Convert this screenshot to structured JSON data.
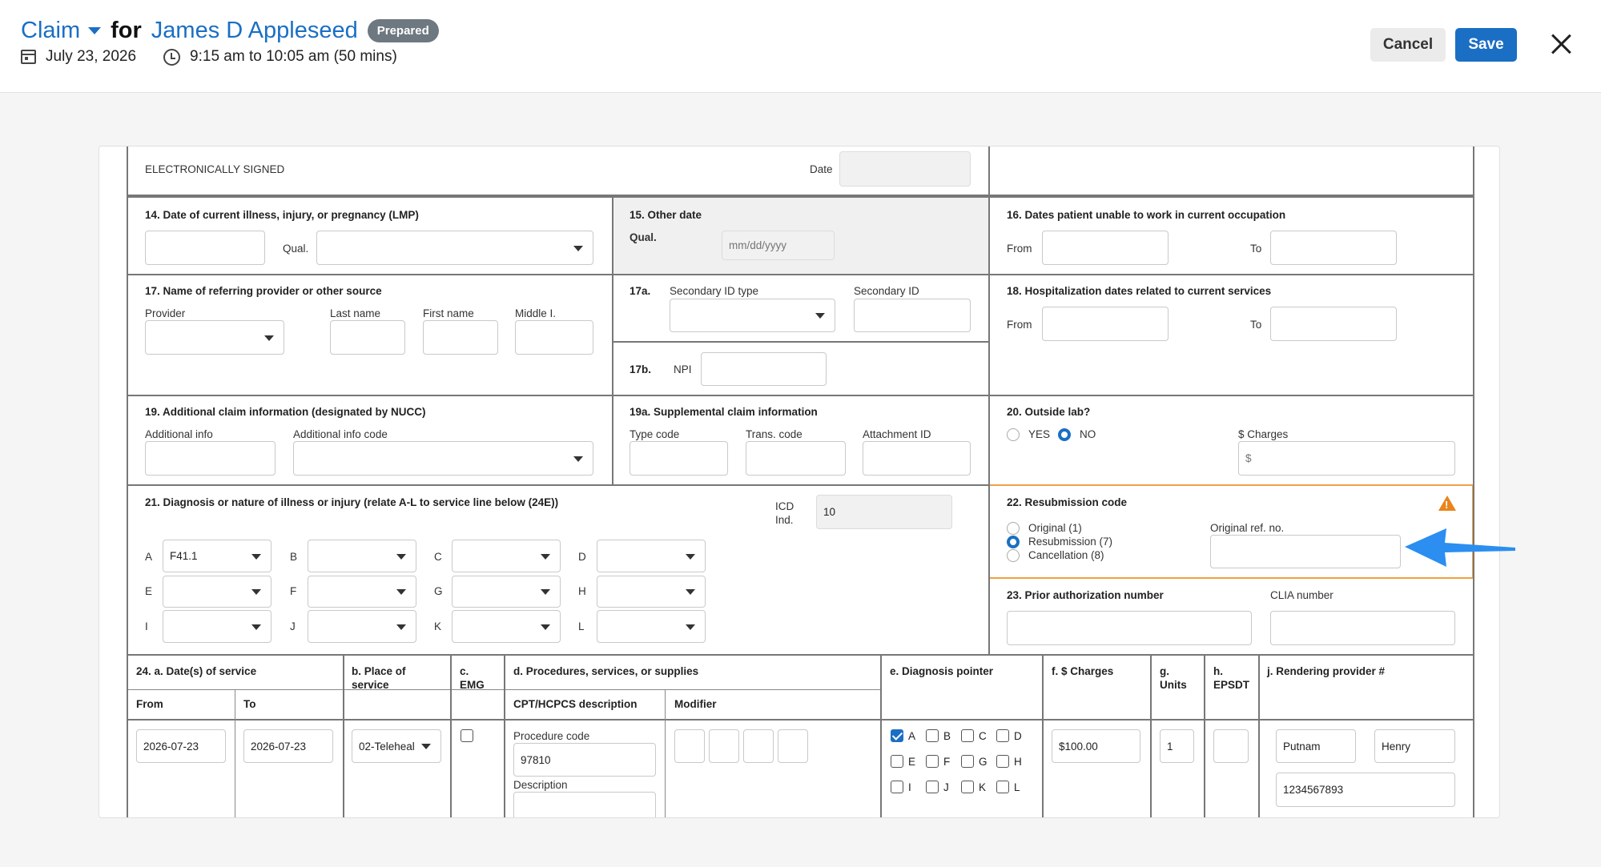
{
  "header": {
    "claim_label": "Claim",
    "for_label": "for",
    "patient_name": "James D Appleseed",
    "status_badge": "Prepared",
    "date": "July 23, 2026",
    "time": "9:15 am to 10:05 am (50 mins)",
    "cancel_label": "Cancel",
    "save_label": "Save"
  },
  "colors": {
    "accent": "#1a6fc4",
    "warning": "#e8851c",
    "highlight_border": "#f0a044",
    "badge": "#6e7880"
  },
  "signed": {
    "text": "ELECTRONICALLY SIGNED",
    "date_label": "Date"
  },
  "box14": {
    "title": "14. Date of current illness, injury, or pregnancy (LMP)",
    "qual_label": "Qual."
  },
  "box15": {
    "title": "15. Other date",
    "qual_label": "Qual.",
    "date_placeholder": "mm/dd/yyyy"
  },
  "box16": {
    "title": "16. Dates patient unable to work in current occupation",
    "from_label": "From",
    "to_label": "To"
  },
  "box17": {
    "title": "17. Name of referring provider or other source",
    "provider_label": "Provider",
    "last_name_label": "Last name",
    "first_name_label": "First name",
    "middle_label": "Middle I."
  },
  "box17a": {
    "num": "17a.",
    "secondary_type_label": "Secondary ID type",
    "secondary_id_label": "Secondary ID"
  },
  "box17b": {
    "num": "17b.",
    "npi_label": "NPI"
  },
  "box18": {
    "title": "18. Hospitalization dates related to current services",
    "from_label": "From",
    "to_label": "To"
  },
  "box19": {
    "title": "19. Additional claim information (designated by NUCC)",
    "info_label": "Additional info",
    "code_label": "Additional info code"
  },
  "box19a": {
    "title": "19a. Supplemental claim information",
    "type_label": "Type code",
    "trans_label": "Trans. code",
    "attach_label": "Attachment ID"
  },
  "box20": {
    "title": "20. Outside lab?",
    "yes_label": "YES",
    "no_label": "NO",
    "selected": "NO",
    "charges_label": "$ Charges",
    "charges_placeholder": "$"
  },
  "box21": {
    "title": "21. Diagnosis or nature of illness or injury (relate A-L to service line below (24E))",
    "icd_label_1": "ICD",
    "icd_label_2": "Ind.",
    "icd_value": "10",
    "letters": [
      "A",
      "B",
      "C",
      "D",
      "E",
      "F",
      "G",
      "H",
      "I",
      "J",
      "K",
      "L"
    ],
    "values": [
      "F41.1",
      "",
      "",
      "",
      "",
      "",
      "",
      "",
      "",
      "",
      "",
      ""
    ]
  },
  "box22": {
    "title": "22. Resubmission code",
    "options": [
      "Original (1)",
      "Resubmission (7)",
      "Cancellation (8)"
    ],
    "selected": "Resubmission (7)",
    "orig_ref_label": "Original ref. no.",
    "warning_icon": "warning-triangle-icon"
  },
  "box23": {
    "title": "23. Prior authorization number",
    "clia_label": "CLIA number"
  },
  "box24": {
    "a_title": "24. a. Date(s) of service",
    "from_label": "From",
    "to_label": "To",
    "b_title_1": "b. Place of",
    "b_title_2": "service",
    "c_title_1": "c.",
    "c_title_2": "EMG",
    "d_title": "d. Procedures, services, or supplies",
    "cpt_label": "CPT/HCPCS description",
    "modifier_label": "Modifier",
    "e_title": "e. Diagnosis pointer",
    "f_title": "f. $ Charges",
    "g_title_1": "g.",
    "g_title_2": "Units",
    "h_title_1": "h.",
    "h_title_2": "EPSDT",
    "j_title": "j. Rendering provider #",
    "line": {
      "from": "2026-07-23",
      "to": "2026-07-23",
      "place": "02-Teleheal",
      "emg_checked": false,
      "procedure_label": "Procedure code",
      "procedure_code": "97810",
      "description_label": "Description",
      "pointers": [
        "A",
        "B",
        "C",
        "D",
        "E",
        "F",
        "G",
        "H",
        "I",
        "J",
        "K",
        "L"
      ],
      "pointer_checked": [
        "A"
      ],
      "charges": "$100.00",
      "units": "1",
      "provider_last": "Putnam",
      "provider_first": "Henry",
      "provider_id": "1234567893"
    }
  }
}
